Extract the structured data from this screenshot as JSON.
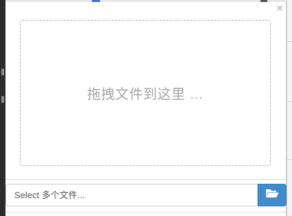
{
  "uploader": {
    "close_glyph": "×",
    "drop_zone_text": "拖拽文件到这里 …",
    "caption_placeholder": "Select 多个文件...",
    "browse_icon": "folder-open-icon",
    "colors": {
      "button": "#428bca",
      "drop_border": "#a9a9a9",
      "drop_text": "#a6a6a6"
    }
  }
}
